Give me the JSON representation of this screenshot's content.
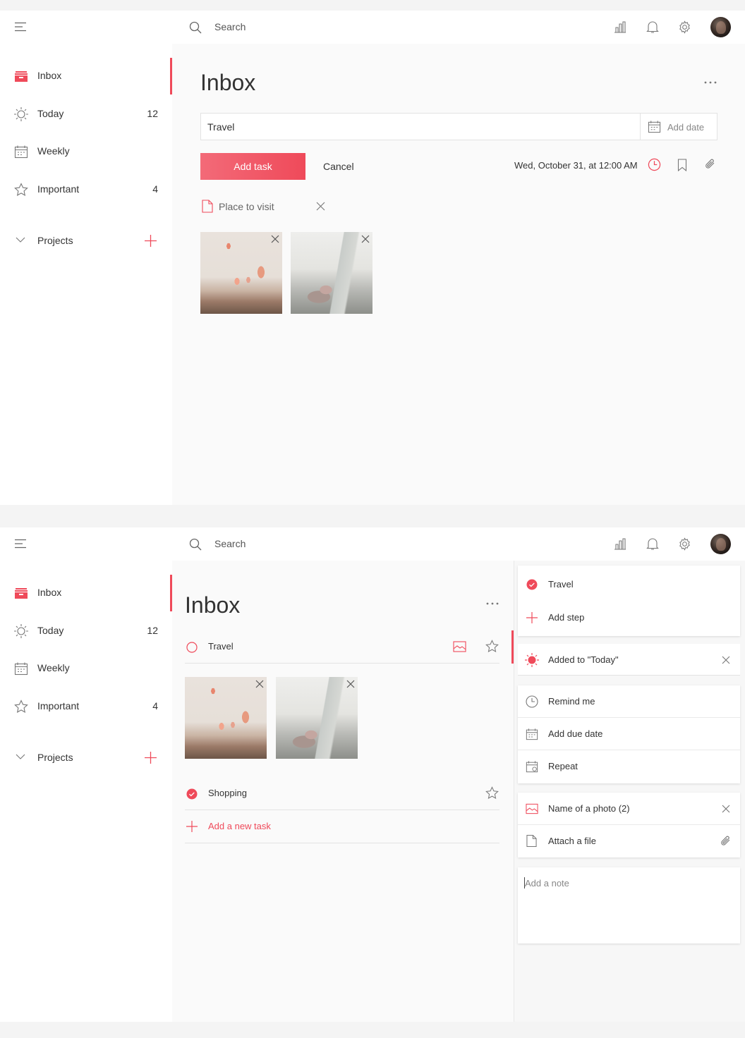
{
  "colors": {
    "accent": "#ef4a5a",
    "text": "#333333",
    "muted": "#888888",
    "border": "#e3e3e3"
  },
  "topbar": {
    "search_placeholder": "Search",
    "icons": [
      "menu-icon",
      "search-icon",
      "stats-icon",
      "bell-icon",
      "gear-icon",
      "avatar"
    ]
  },
  "sidebar": {
    "items": [
      {
        "label": "Inbox",
        "count": "",
        "icon": "inbox-icon"
      },
      {
        "label": "Today",
        "count": "12",
        "icon": "sun-icon"
      },
      {
        "label": "Weekly",
        "count": "",
        "icon": "calendar-icon"
      },
      {
        "label": "Important",
        "count": "4",
        "icon": "star-icon"
      }
    ],
    "projects": {
      "label": "Projects",
      "icon": "chevron-down-icon",
      "add_icon": "plus-icon"
    }
  },
  "screen1": {
    "title": "Inbox",
    "task_input_value": "Travel",
    "add_date_label": "Add date",
    "add_task_label": "Add task",
    "cancel_label": "Cancel",
    "due_text": "Wed, October 31, at 12:00 AM",
    "attachment_label": "Place to visit"
  },
  "screen2": {
    "title": "Inbox",
    "tasks": [
      {
        "label": "Travel",
        "done": false
      },
      {
        "label": "Shopping",
        "done": true
      }
    ],
    "add_new_task_label": "Add a new task",
    "detail": {
      "task_title": "Travel",
      "add_step": "Add step",
      "added_to_today": "Added to \"Today\"",
      "remind_me": "Remind me",
      "add_due_date": "Add due date",
      "repeat": "Repeat",
      "photo_name": "Name of a photo (2)",
      "attach_file": "Attach a file",
      "note_placeholder": "Add a note"
    }
  }
}
